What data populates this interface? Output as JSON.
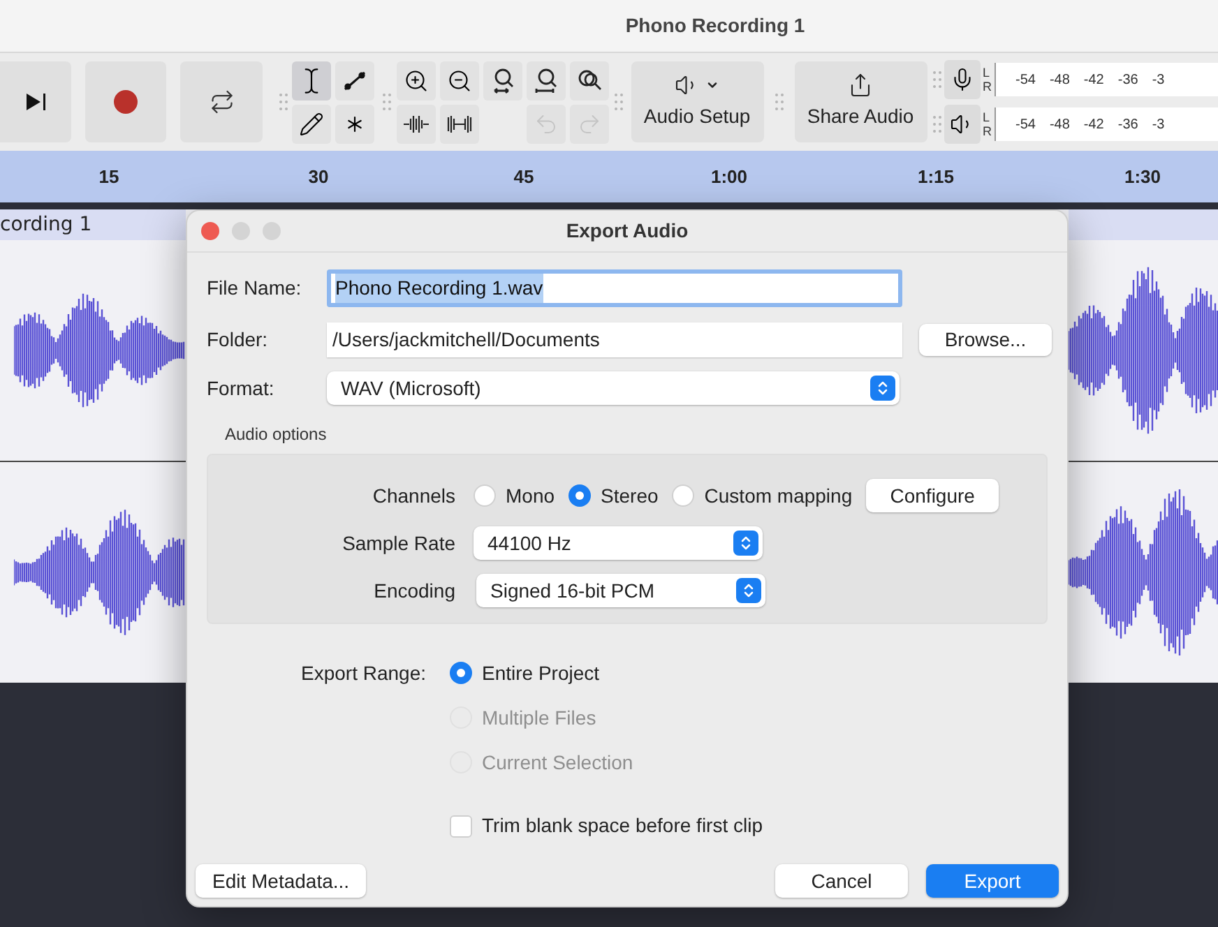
{
  "window": {
    "title": "Phono Recording 1"
  },
  "transport": [
    {
      "kind": "skip_end"
    },
    {
      "kind": "record"
    },
    {
      "kind": "loop"
    }
  ],
  "edit_tools": [
    {
      "kind": "ibeam",
      "selected": true
    },
    {
      "kind": "envelope",
      "selected": false
    },
    {
      "kind": "draw",
      "selected": false
    },
    {
      "kind": "multi",
      "selected": false
    }
  ],
  "zoom_tools": [
    {
      "kind": "zoom_in"
    },
    {
      "kind": "zoom_out"
    },
    {
      "kind": "fit_selection"
    },
    {
      "kind": "fit_project"
    },
    {
      "kind": "zoom_toggle"
    },
    {
      "kind": "trim"
    },
    {
      "kind": "silence"
    }
  ],
  "history_buttons": [
    {
      "kind": "undo",
      "disabled": true
    },
    {
      "kind": "redo",
      "disabled": true
    }
  ],
  "audio_setup": {
    "label": "Audio Setup"
  },
  "share_audio": {
    "label": "Share Audio"
  },
  "meters": [
    {
      "kind": "record",
      "channels": [
        "L",
        "R"
      ],
      "ticks": [
        "-54",
        "-48",
        "-42",
        "-36",
        "-3"
      ]
    },
    {
      "kind": "playback",
      "channels": [
        "L",
        "R"
      ],
      "ticks": [
        "-54",
        "-48",
        "-42",
        "-36",
        "-3"
      ]
    }
  ],
  "ruler": {
    "labels": [
      "15",
      "30",
      "45",
      "1:00",
      "1:15",
      "1:30"
    ]
  },
  "track": {
    "name": "cording 1"
  },
  "dialog": {
    "title": "Export Audio",
    "file_name": {
      "label": "File Name:",
      "value": "Phono Recording 1.wav",
      "focused": true
    },
    "folder": {
      "label": "Folder:",
      "value": "/Users/jackmitchell/Documents",
      "button": "Browse..."
    },
    "format": {
      "label": "Format:",
      "value": "WAV (Microsoft)"
    },
    "audio_options": {
      "title": "Audio options",
      "channels": {
        "label": "Channels",
        "options": [
          {
            "label": "Mono",
            "selected": false
          },
          {
            "label": "Stereo",
            "selected": true
          },
          {
            "label": "Custom mapping",
            "selected": false
          }
        ],
        "button": "Configure"
      },
      "sample_rate": {
        "label": "Sample Rate",
        "value": "44100 Hz"
      },
      "encoding": {
        "label": "Encoding",
        "value": "Signed 16-bit PCM"
      }
    },
    "export_range": {
      "label": "Export Range:",
      "options": [
        {
          "label": "Entire Project",
          "selected": true,
          "disabled": false
        },
        {
          "label": "Multiple Files",
          "selected": false,
          "disabled": true
        },
        {
          "label": "Current Selection",
          "selected": false,
          "disabled": true
        }
      ]
    },
    "trim": {
      "label": "Trim blank space before first clip",
      "checked": false
    },
    "buttons": [
      {
        "label": "Edit Metadata...",
        "kind": "secondary"
      },
      {
        "label": "Cancel",
        "kind": "default"
      },
      {
        "label": "Export",
        "kind": "primary"
      }
    ]
  }
}
